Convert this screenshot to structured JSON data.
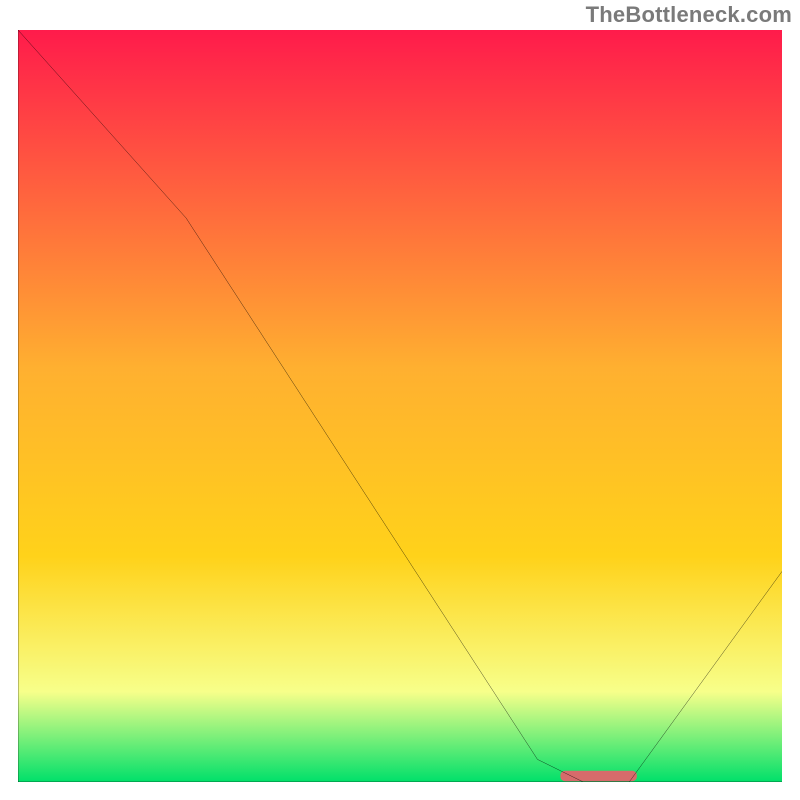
{
  "watermark": "TheBottleneck.com",
  "colors": {
    "gradient_top": "#ff1b4b",
    "gradient_mid": "#ffd21a",
    "gradient_low": "#f7ff8a",
    "gradient_bottom": "#00e06a",
    "curve": "#000000",
    "axis": "#000000",
    "marker": "#d66b6b"
  },
  "chart_data": {
    "type": "line",
    "title": "",
    "xlabel": "",
    "ylabel": "",
    "xlim": [
      0,
      100
    ],
    "ylim": [
      0,
      100
    ],
    "x": [
      0,
      22,
      68,
      74,
      80,
      100
    ],
    "values": [
      100,
      75,
      3,
      0,
      0,
      28
    ],
    "marker_band": {
      "x_start": 71,
      "x_end": 81,
      "y": 0.8
    }
  }
}
